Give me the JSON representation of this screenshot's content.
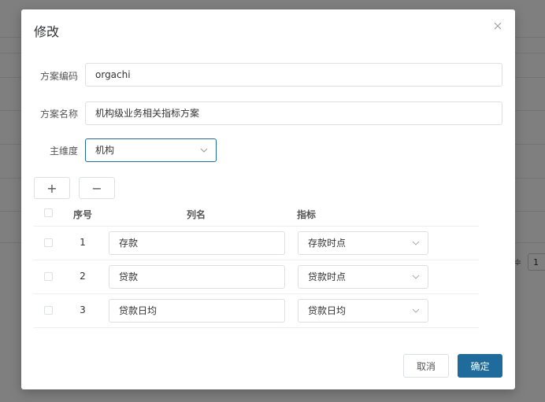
{
  "background": {
    "pager_sep": "≑",
    "pager_value": "1"
  },
  "modal": {
    "title": "修改",
    "close_icon": "close-icon"
  },
  "form": {
    "code_label": "方案编码",
    "code_value": "orgachi",
    "name_label": "方案名称",
    "name_value": "机构级业务相关指标方案",
    "dimension_label": "主维度",
    "dimension_value": "机构"
  },
  "toolbar": {
    "add_symbol": "+",
    "remove_symbol": "−"
  },
  "table": {
    "headers": {
      "seq": "序号",
      "column_name": "列名",
      "indicator": "指标"
    },
    "rows": [
      {
        "seq": "1",
        "column_name": "存款",
        "indicator": "存款时点"
      },
      {
        "seq": "2",
        "column_name": "贷款",
        "indicator": "贷款时点"
      },
      {
        "seq": "3",
        "column_name": "贷款日均",
        "indicator": "贷款日均"
      }
    ]
  },
  "footer": {
    "cancel_label": "取消",
    "ok_label": "确定"
  },
  "colors": {
    "primary": "#1f6b9b",
    "mask": "rgba(0,0,0,0.5)",
    "border": "#dcdfe6"
  }
}
